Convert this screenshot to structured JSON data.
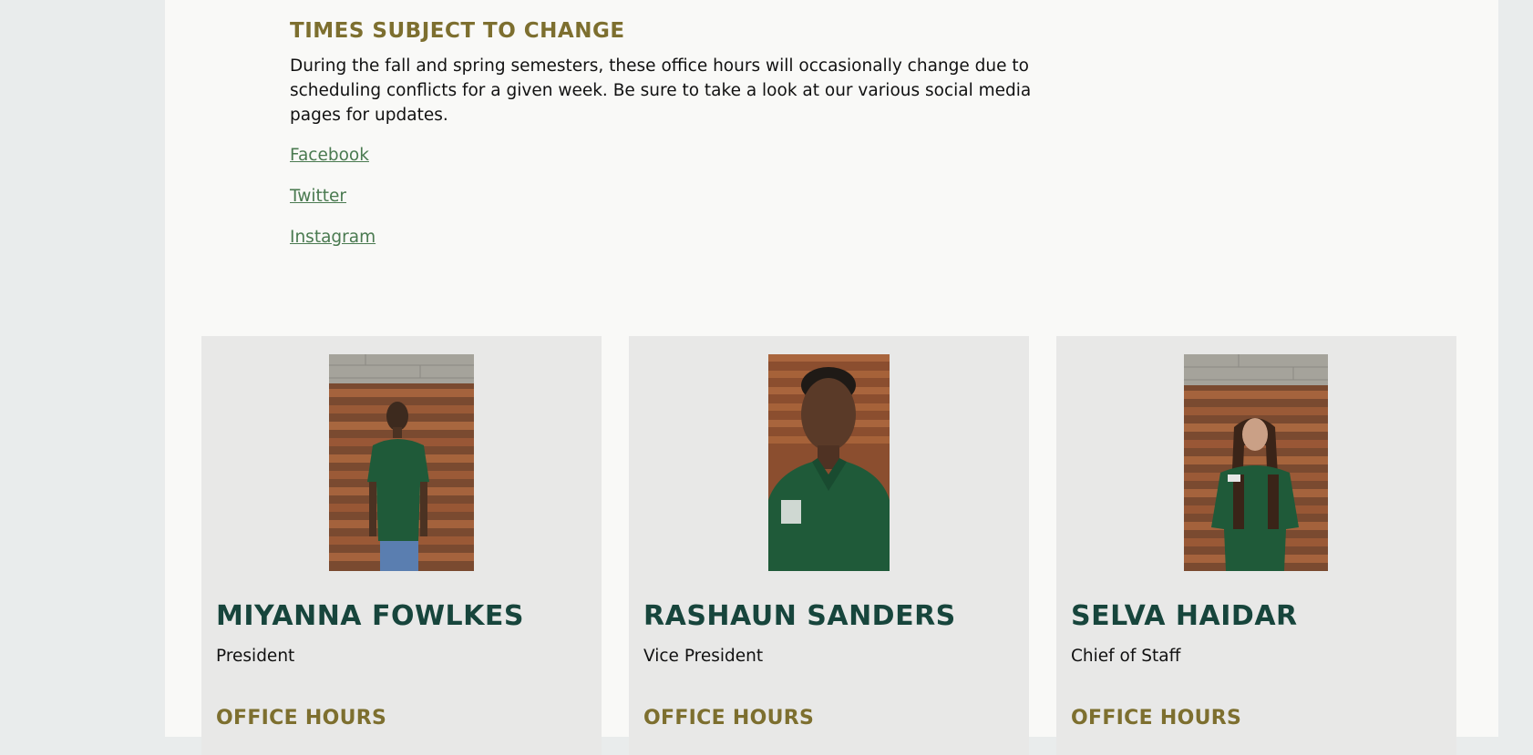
{
  "notice": {
    "heading": "TIMES SUBJECT TO CHANGE",
    "body": "During the fall and spring semesters, these office hours will occasionally change due to scheduling conflicts for a given week. Be sure to take a look at our various social media pages for updates.",
    "links": [
      "Facebook",
      "Twitter",
      "Instagram"
    ]
  },
  "officers": [
    {
      "name": "MIYANNA FOWLKES",
      "role": "President",
      "hours_label": "OFFICE HOURS"
    },
    {
      "name": "RASHAUN SANDERS",
      "role": "Vice President",
      "hours_label": "OFFICE HOURS"
    },
    {
      "name": "SELVA HAIDAR",
      "role": "Chief of Staff",
      "hours_label": "OFFICE HOURS"
    }
  ],
  "colors": {
    "page_bg": "#f9f9f7",
    "side_bg": "#e9ecec",
    "card_bg": "#e8e8e7",
    "gold": "#7d6f2f",
    "name_green": "#17453c",
    "link_green": "#4a7a50",
    "shirt_green": "#1f5a39"
  }
}
